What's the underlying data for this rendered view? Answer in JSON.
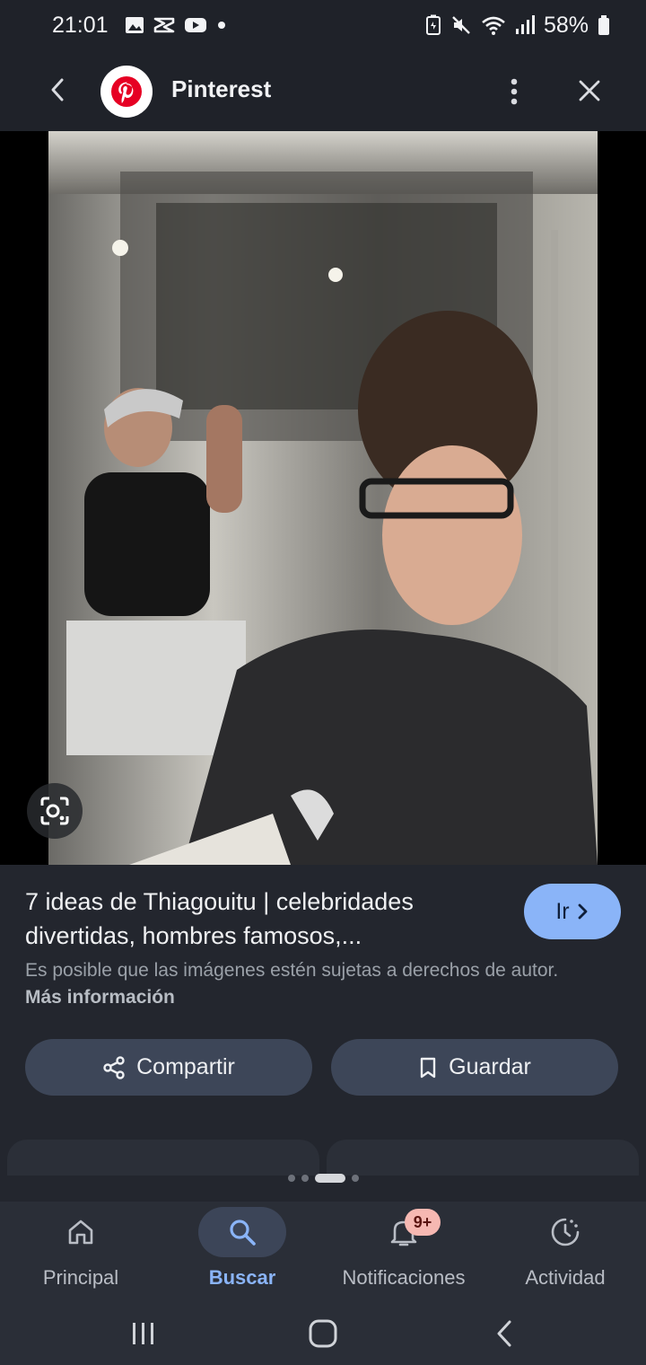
{
  "status_bar": {
    "time": "21:01",
    "battery_percent": "58%",
    "icons_left": [
      "gallery-icon",
      "capcut-icon",
      "youtube-icon",
      "dot-icon"
    ],
    "icons_right": [
      "battery-saver-icon",
      "mute-icon",
      "wifi-icon",
      "signal-icon",
      "battery-icon"
    ]
  },
  "app_bar": {
    "title": "Pinterest",
    "brand_color": "#e60023"
  },
  "result": {
    "title": "7 ideas de Thiagouitu | celebridades divertidas, hombres famosos,...",
    "go_label": "Ir",
    "copyright_text": "Es posible que las imágenes estén sujetas a derechos de autor.",
    "more_info_label": "Más información",
    "share_label": "Compartir",
    "save_label": "Guardar"
  },
  "pager": {
    "count": 4,
    "active_index": 2
  },
  "bottom_nav": {
    "items": [
      {
        "label": "Principal",
        "icon": "home-icon",
        "active": false
      },
      {
        "label": "Buscar",
        "icon": "search-icon",
        "active": true
      },
      {
        "label": "Notificaciones",
        "icon": "bell-icon",
        "active": false,
        "badge": "9+"
      },
      {
        "label": "Actividad",
        "icon": "activity-icon",
        "active": false
      }
    ]
  },
  "colors": {
    "accent": "#8ab4f8",
    "background": "#1f2229",
    "button_bg": "#3d4658"
  }
}
